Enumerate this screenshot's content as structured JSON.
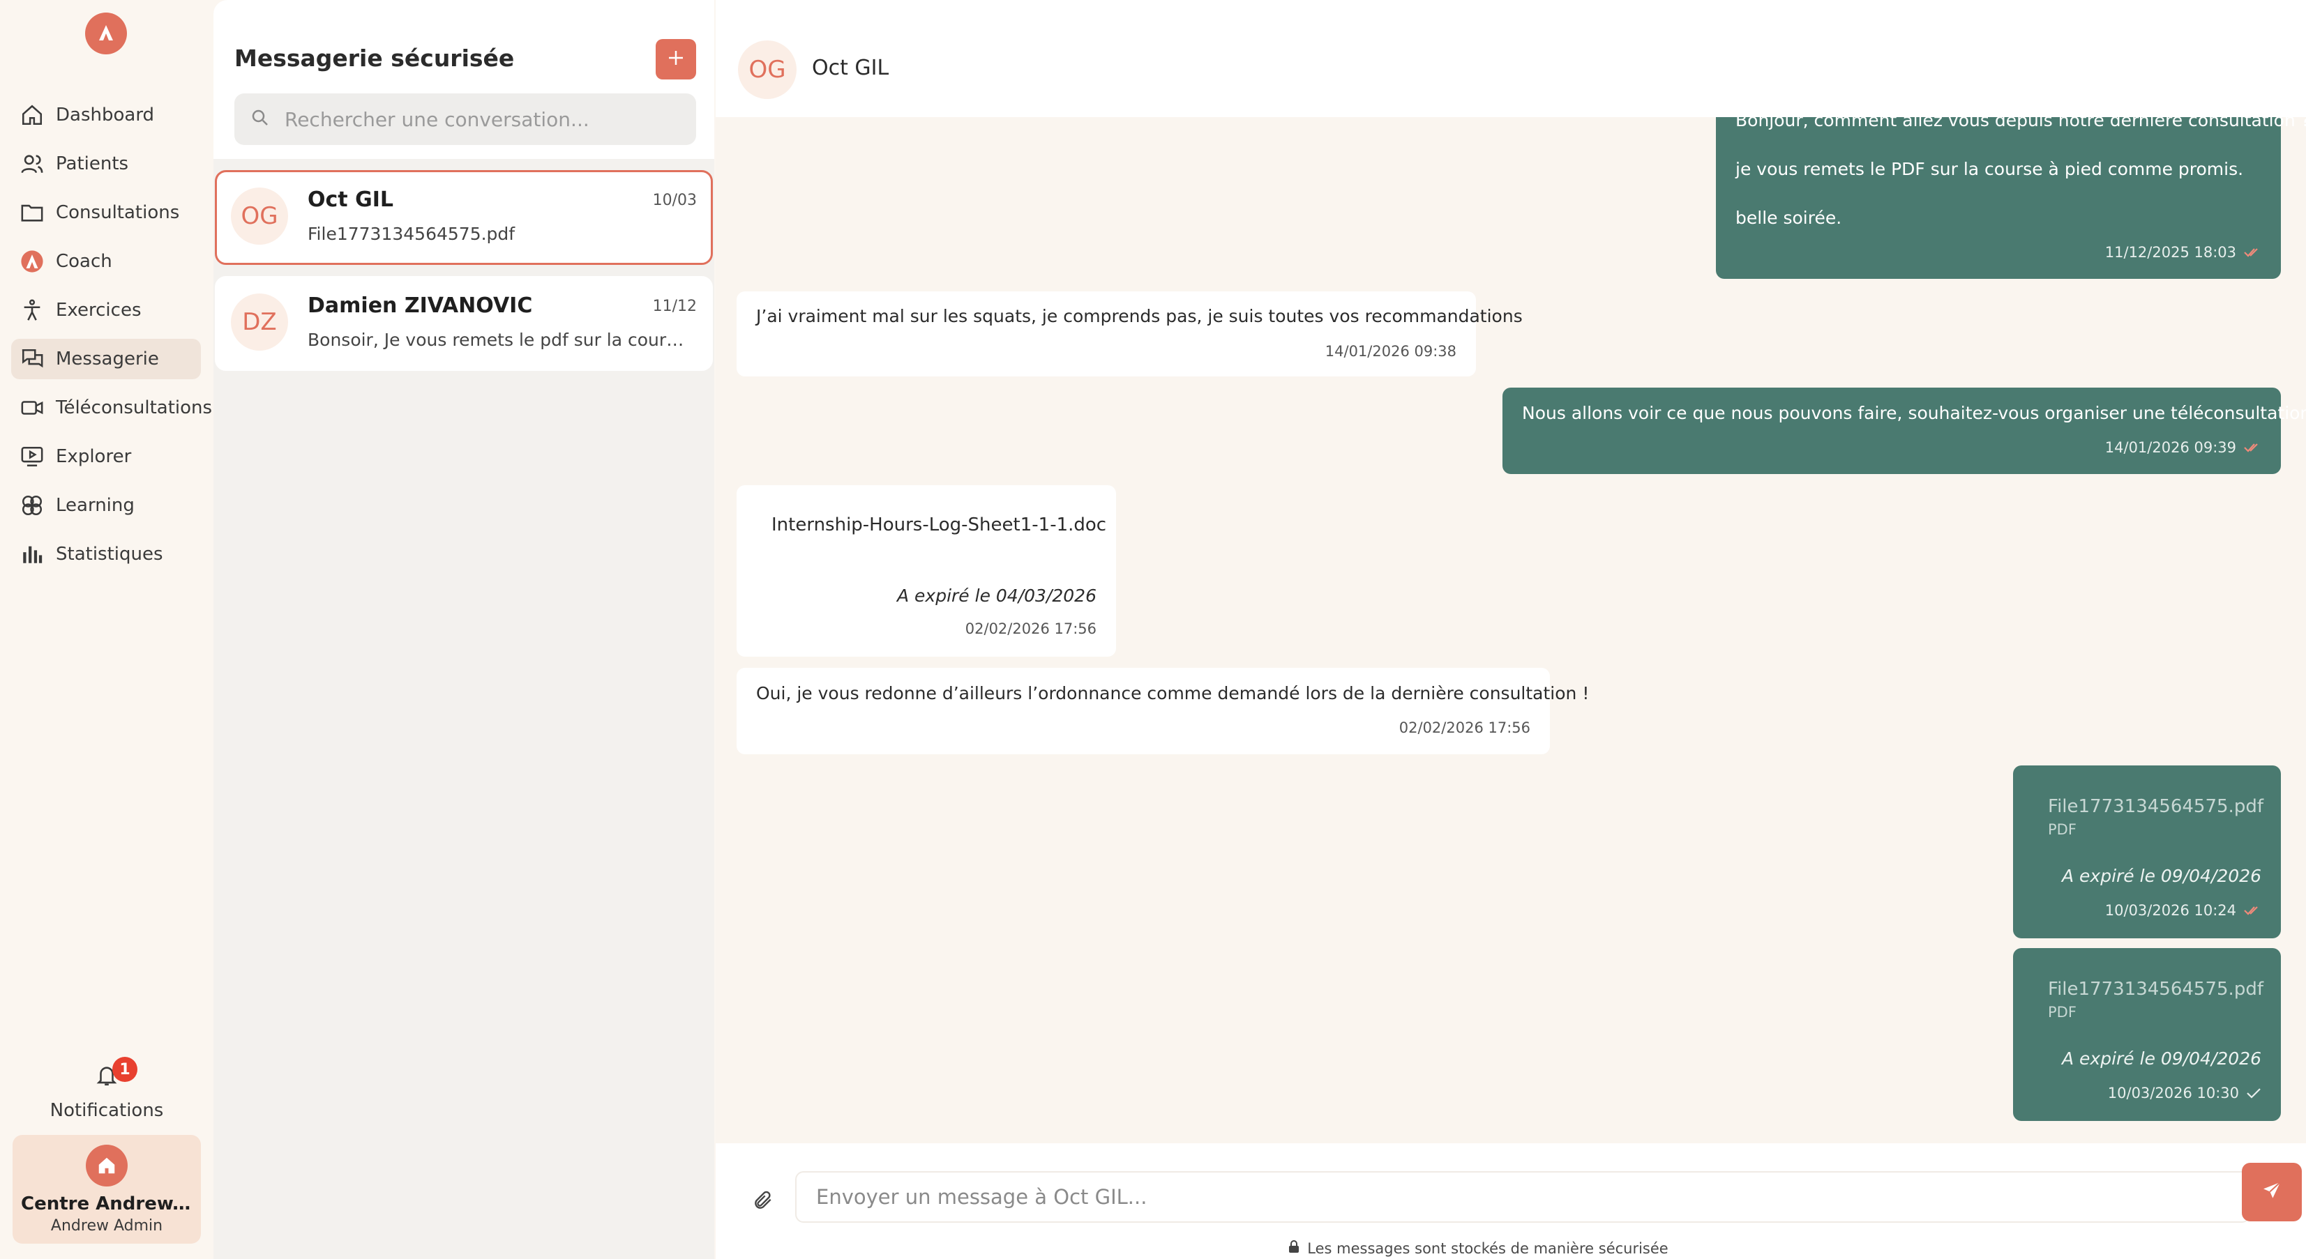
{
  "sidebar": {
    "logo_icon": "brand-logo-icon",
    "items": [
      {
        "label": "Dashboard",
        "icon": "home-icon"
      },
      {
        "label": "Patients",
        "icon": "users-icon"
      },
      {
        "label": "Consultations",
        "icon": "folder-icon"
      },
      {
        "label": "Coach",
        "icon": "brand-logo-icon"
      },
      {
        "label": "Exercices",
        "icon": "figure-icon"
      },
      {
        "label": "Messagerie",
        "icon": "chat-icon",
        "active": true
      },
      {
        "label": "Téléconsultations",
        "icon": "video-icon"
      },
      {
        "label": "Explorer",
        "icon": "play-screen-icon"
      },
      {
        "label": "Learning",
        "icon": "brain-icon"
      },
      {
        "label": "Statistiques",
        "icon": "bar-chart-icon"
      }
    ],
    "notifications": {
      "label": "Notifications",
      "count": "1"
    },
    "center": {
      "name": "Centre Andrew...",
      "user": "Andrew Admin"
    }
  },
  "conversations": {
    "title": "Messagerie sécurisée",
    "search_placeholder": "Rechercher une conversation...",
    "items": [
      {
        "initials": "OG",
        "name": "Oct GIL",
        "date": "10/03",
        "preview": "File1773134564575.pdf",
        "active": true
      },
      {
        "initials": "DZ",
        "name": "Damien ZIVANOVIC",
        "date": "11/12",
        "preview": "Bonsoir, Je vous remets le pdf sur la course à pied comme promis."
      }
    ]
  },
  "chat": {
    "contact": {
      "initials": "OG",
      "name": "Oct GIL"
    },
    "messages": [
      {
        "dir": "out",
        "lines": [
          "Bonjour, comment allez vous depuis notre dernière consultation ?",
          "je vous remets le PDF sur la course à pied comme promis.",
          "belle soirée."
        ],
        "time": "11/12/2025 18:03",
        "status": "read"
      },
      {
        "dir": "in",
        "text": "J’ai vraiment mal sur les squats, je comprends pas, je suis toutes vos recommandations",
        "time": "14/01/2026 09:38"
      },
      {
        "dir": "out",
        "text": "Nous allons voir ce que nous pouvons faire, souhaitez-vous organiser une téléconsultation ?",
        "time": "14/01/2026 09:39",
        "status": "read"
      },
      {
        "dir": "in",
        "file": "Internship-Hours-Log-Sheet1-1-1.doc",
        "expired": "A expiré le 04/03/2026",
        "time": "02/02/2026 17:56"
      },
      {
        "dir": "in",
        "text": "Oui, je vous redonne d’ailleurs l’ordonnance comme demandé lors de la dernière consultation !",
        "time": "02/02/2026 17:56"
      },
      {
        "dir": "out",
        "file": "File1773134564575.pdf",
        "filetype": "PDF",
        "expired": "A expiré le 09/04/2026",
        "time": "10/03/2026 10:24",
        "status": "read"
      },
      {
        "dir": "out",
        "file": "File1773134564575.pdf",
        "filetype": "PDF",
        "expired": "A expiré le 09/04/2026",
        "time": "10/03/2026 10:30",
        "status": "sent"
      }
    ],
    "composer": {
      "placeholder": "Envoyer un message à Oct GIL...",
      "secure_note": "Les messages sont stockés de manière sécurisée"
    }
  },
  "colors": {
    "accent": "#e0705c",
    "outgoing": "#4a7a70",
    "background": "#fbf6f0"
  }
}
